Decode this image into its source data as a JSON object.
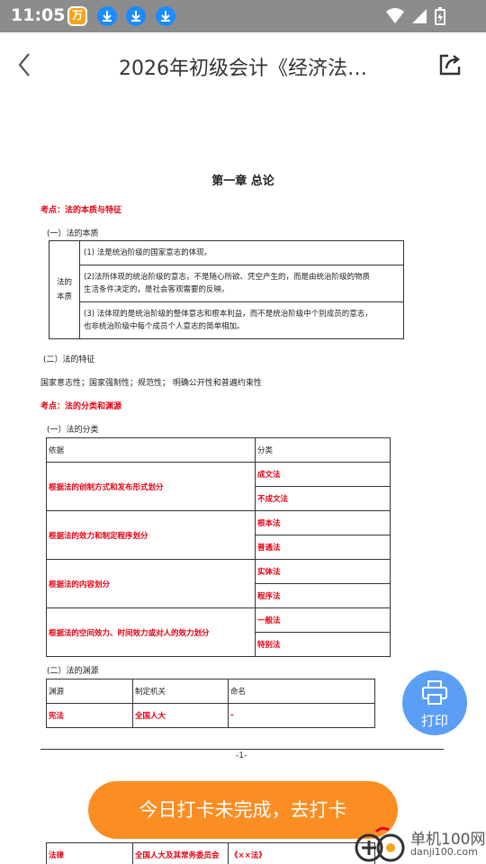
{
  "status_bar": {
    "time": "11:05",
    "app_badge": "万"
  },
  "header": {
    "title": "2026年初级会计《经济法…"
  },
  "doc": {
    "chapter_title": "第一章  总论",
    "sec1_heading": "考点：法的本质与特征",
    "sec1_sub1": "(一）法的本质",
    "essence_label_1": "法的",
    "essence_label_2": "本质",
    "essence_items": [
      "(1) 法是统治阶级的国家意志的体现。",
      "(2)法所体现的统治阶级的意志，不是随心所欲、凭空产生的，而是由统治阶级的物质",
      "生活条件决定的，是社会客观需要的反映。",
      "(3) 法体现的是统治阶级的整体意志和根本利益，而不是统治阶级中个别成员的意志，",
      "也非统治阶级中每个成员个人意志的简单相加。"
    ],
    "sec1_sub2": "(二）法的特征",
    "features": "国家意志性；国家强制性；规范性；  明确公开性和普遍约束性",
    "sec2_heading": "考点：法的分类和渊源",
    "sec2_sub1": "(一）法的分类",
    "class_table": {
      "headers": [
        "依据",
        "分类"
      ],
      "rows": [
        {
          "basis": "根据法的创制方式和发布形式划分",
          "types": [
            "成文法",
            "不成文法"
          ]
        },
        {
          "basis": "根据法的效力和制定程序划分",
          "types": [
            "根本法",
            "普通法"
          ]
        },
        {
          "basis": "根据法的内容划分",
          "types": [
            "实体法",
            "程序法"
          ]
        },
        {
          "basis": "根据法的空间效力、时间效力或对人的效力划分",
          "types": [
            "一般法",
            "特别法"
          ]
        }
      ]
    },
    "sec2_sub2": "(二）法的渊源",
    "source_table": {
      "headers": [
        "渊源",
        "制定机关",
        "命名"
      ],
      "rows": [
        [
          "宪法",
          "全国人大",
          "-"
        ]
      ]
    },
    "page_number": "-1-",
    "next_page_row": [
      "法律",
      "全国人大及其常务委员会",
      "《××法》"
    ]
  },
  "print_button": {
    "label": "打印"
  },
  "checkin": {
    "label": "今日打卡未完成，去打卡"
  },
  "watermark": {
    "cn": "单机100网",
    "url": "danji100.com"
  },
  "colors": {
    "accent_red": "#e60012",
    "checkin_orange": "#fb8d23",
    "print_blue": "#5b9ef5",
    "status_gray": "#8c8c8c"
  }
}
